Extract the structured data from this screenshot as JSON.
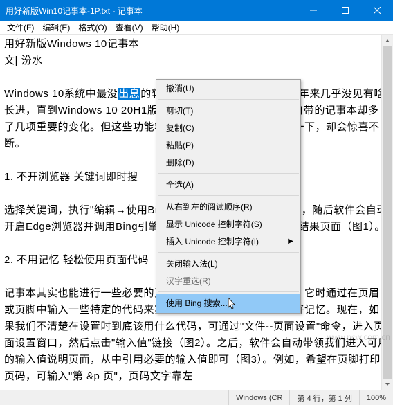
{
  "title": "用好新版Win10记事本-1P.txt - 记事本",
  "menubar": [
    "文件(F)",
    "编辑(E)",
    "格式(O)",
    "查看(V)",
    "帮助(H)"
  ],
  "content": {
    "heading": "用好新版Windows 10记事本",
    "byline": "文| 汾水",
    "p1a": "Windows 10系统中最没",
    "sel": "出息",
    "p1b": "的软件也许要数\"记事本\"了，十多年来几乎没见有啥长进，直到Windows 10 20H1版的到来，新版的Windows 10自带的记事本却多了几项重要的变化。但这些功能容易被我们所忽略，但随手用一下，却会惊喜不断。",
    "h1": "1. 不开浏览器 关键词即时搜",
    "p2": "选择关键词，执行\"编辑→使用Bing搜索\"，或按下Ctrl+E组合键，随后软件会自动开启Edge浏览器并调用Bing引擎进行搜索并显示包含关键词的结果页面（图1）。",
    "h2": "2. 不用记忆 轻松使用页面代码",
    "p3": "记事本其实也能进行一些必要的页面格式输出设置。我们知道，它时通过在页眉或页脚中输入一些特定的代码来实现的，但是这些代码可能不好记忆。现在，如果我们不清楚在设置时到底该用什么代码，可通过\"文件--页面设置\"命令，进入页面设置窗口，然后点击\"输入值\"链接（图2）。之后，软件会自动带领我们进入可用的输入值说明页面，从中引用必要的输入值即可（图3）。例如，希望在页脚打印页码，可输入\"第 &p 页\"，页码文字靠左"
  },
  "context_menu": {
    "items": [
      {
        "label": "撤消(U)",
        "enabled": true
      },
      {
        "sep": true
      },
      {
        "label": "剪切(T)",
        "enabled": true
      },
      {
        "label": "复制(C)",
        "enabled": true
      },
      {
        "label": "粘贴(P)",
        "enabled": true
      },
      {
        "label": "删除(D)",
        "enabled": true
      },
      {
        "sep": true
      },
      {
        "label": "全选(A)",
        "enabled": true
      },
      {
        "sep": true
      },
      {
        "label": "从右到左的阅读顺序(R)",
        "enabled": true
      },
      {
        "label": "显示 Unicode 控制字符(S)",
        "enabled": true
      },
      {
        "label": "插入 Unicode 控制字符(I)",
        "enabled": true,
        "submenu": true
      },
      {
        "sep": true
      },
      {
        "label": "关闭输入法(L)",
        "enabled": true
      },
      {
        "label": "汉字重选(R)",
        "enabled": false
      },
      {
        "sep": true
      },
      {
        "label": "使用 Bing 搜索...",
        "enabled": true,
        "hover": true
      }
    ]
  },
  "statusbar": {
    "encoding": "Windows (CR",
    "position": "第 4 行，第 1 列",
    "zoom": "100%"
  },
  "watermark": "www.pcw.com.cn"
}
